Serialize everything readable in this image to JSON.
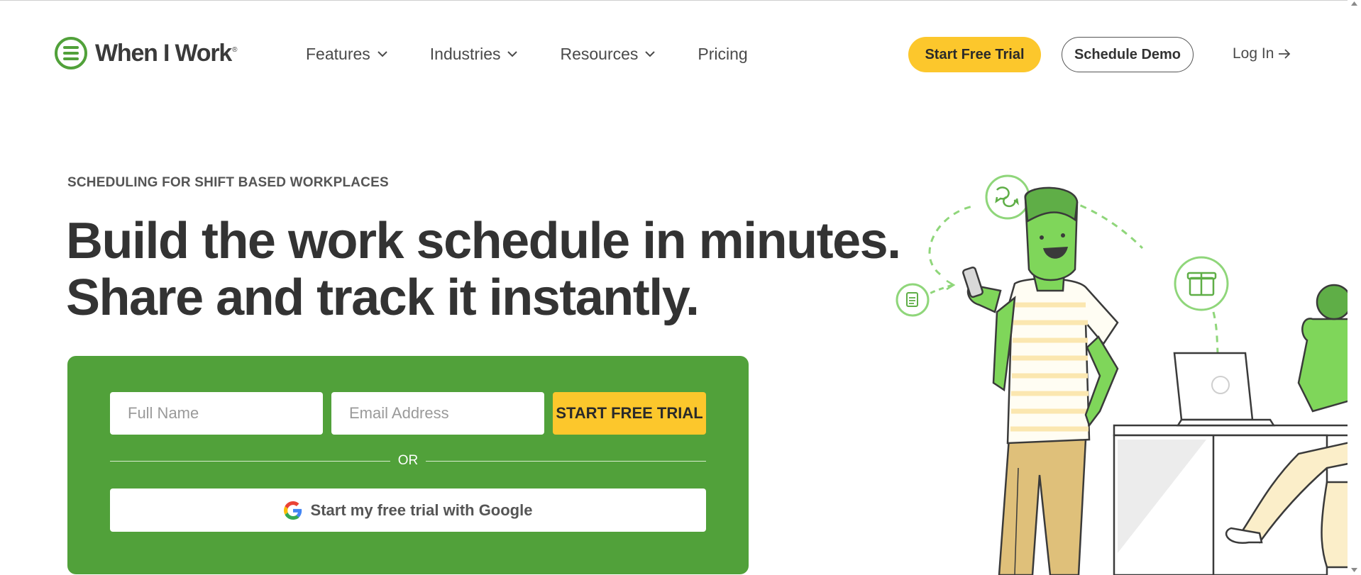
{
  "brand": {
    "name": "When I Work",
    "reg_mark": "®",
    "accent_green": "#51a13a",
    "accent_yellow": "#fcc72c"
  },
  "nav": {
    "items": [
      {
        "label": "Features",
        "icon": "chevron-down-icon"
      },
      {
        "label": "Industries",
        "icon": "chevron-down-icon"
      },
      {
        "label": "Resources",
        "icon": "chevron-down-icon"
      },
      {
        "label": "Pricing"
      }
    ],
    "start_trial": "Start Free Trial",
    "schedule_demo": "Schedule Demo",
    "login": "Log In",
    "login_icon": "arrow-right-icon"
  },
  "hero": {
    "eyebrow": "SCHEDULING FOR SHIFT BASED WORKPLACES",
    "headline_line1": "Build the work schedule in minutes.",
    "headline_line2": "Share and track it instantly."
  },
  "signup": {
    "name_placeholder": "Full Name",
    "email_placeholder": "Email Address",
    "name_value": "",
    "email_value": "",
    "submit_label": "START FREE TRIAL",
    "or_label": "OR",
    "google_label": "Start my free trial with Google",
    "google_icon": "google-icon"
  },
  "illustration": {
    "icons": [
      "chat-bubbles-icon",
      "document-icon",
      "gift-icon"
    ]
  }
}
